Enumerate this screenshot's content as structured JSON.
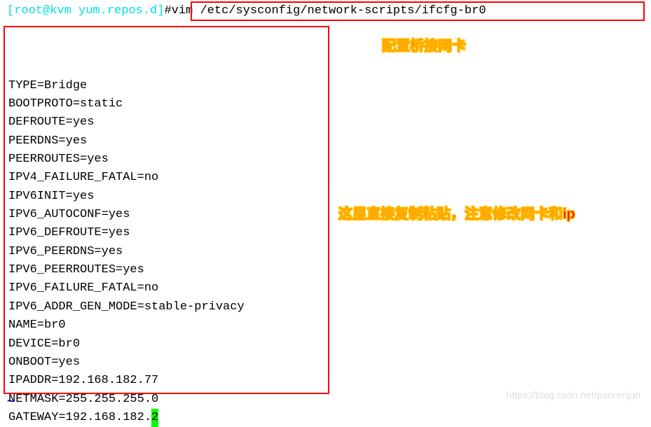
{
  "prompt": {
    "bracket_open": "[",
    "user_host": "root@kvm",
    "space": " ",
    "path": "yum.repos.d",
    "bracket_close": "]",
    "hash": "#"
  },
  "command": "vim /etc/sysconfig/network-scripts/ifcfg-br0",
  "annotations": {
    "top": "配置桥接网卡",
    "middle": "这里直接复制粘贴，注意修改网卡和ip"
  },
  "config_lines": {
    "l00": "",
    "l01": "TYPE=Bridge",
    "l02": "BOOTPROTO=static",
    "l03": "DEFROUTE=yes",
    "l04": "PEERDNS=yes",
    "l05": "PEERROUTES=yes",
    "l06": "IPV4_FAILURE_FATAL=no",
    "l07": "IPV6INIT=yes",
    "l08": "IPV6_AUTOCONF=yes",
    "l09": "IPV6_DEFROUTE=yes",
    "l10": "IPV6_PEERDNS=yes",
    "l11": "IPV6_PEERROUTES=yes",
    "l12": "IPV6_FAILURE_FATAL=no",
    "l13": "IPV6_ADDR_GEN_MODE=stable-privacy",
    "l14": "NAME=br0",
    "l15": "DEVICE=br0",
    "l16": "ONBOOT=yes",
    "l17": "IPADDR=192.168.182.77",
    "l18": "NETMASK=255.255.255.0",
    "l19_prefix": "GATEWAY=192.168.182.",
    "l19_cursor": "2"
  },
  "tilde": "~",
  "watermark": "https://blog.csdn.net/panrenjun"
}
